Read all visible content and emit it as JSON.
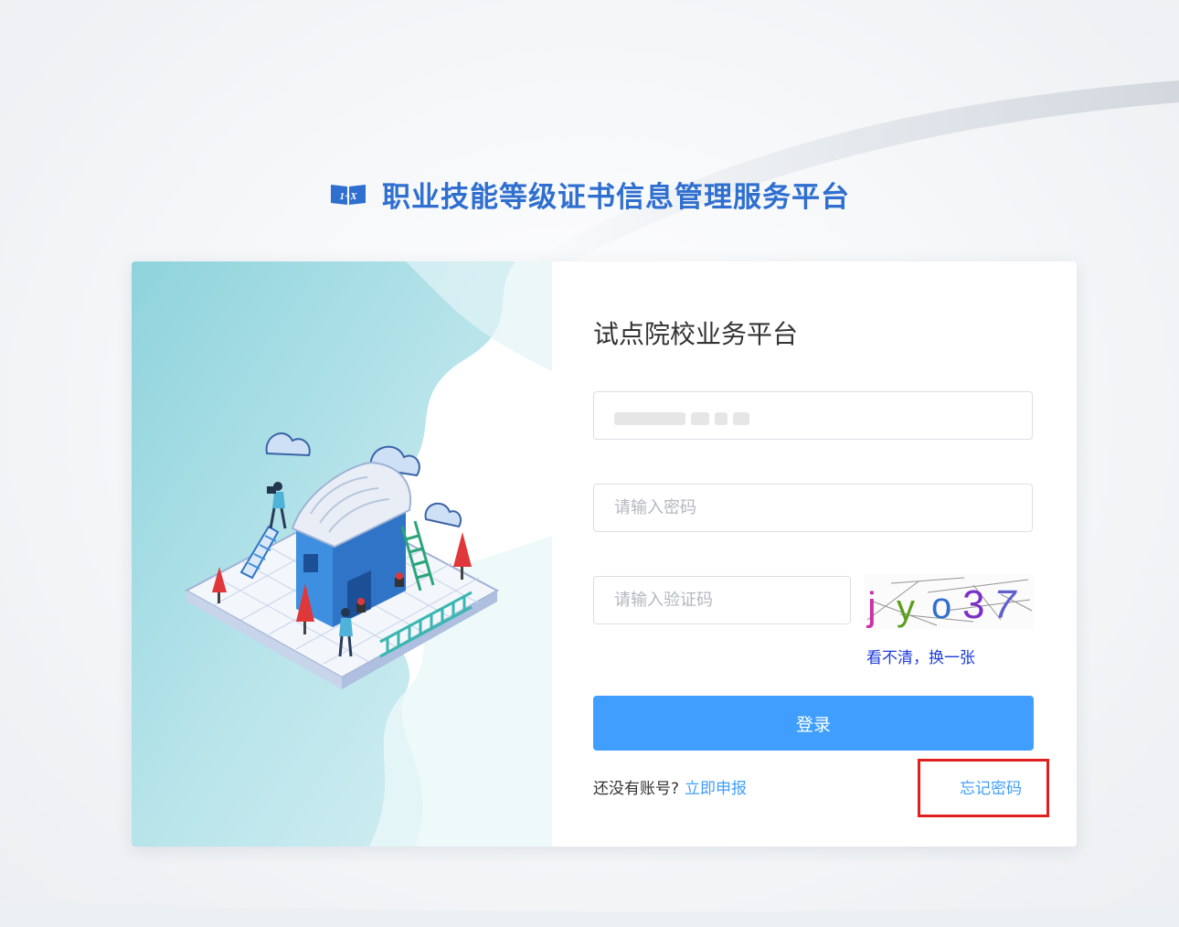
{
  "header": {
    "logo_text": "1+X",
    "title": "职业技能等级证书信息管理服务平台"
  },
  "form": {
    "title": "试点院校业务平台",
    "username_value": "",
    "password_placeholder": "请输入密码",
    "captcha_placeholder": "请输入验证码",
    "captcha_text": "jyo37",
    "refresh_label": "看不清，换一张",
    "login_label": "登录",
    "no_account_text": "还没有账号?",
    "signup_label": "立即申报",
    "forgot_label": "忘记密码"
  },
  "colors": {
    "primary": "#409eff",
    "title_blue": "#2f6fd0",
    "highlight_red": "#e0201c"
  }
}
